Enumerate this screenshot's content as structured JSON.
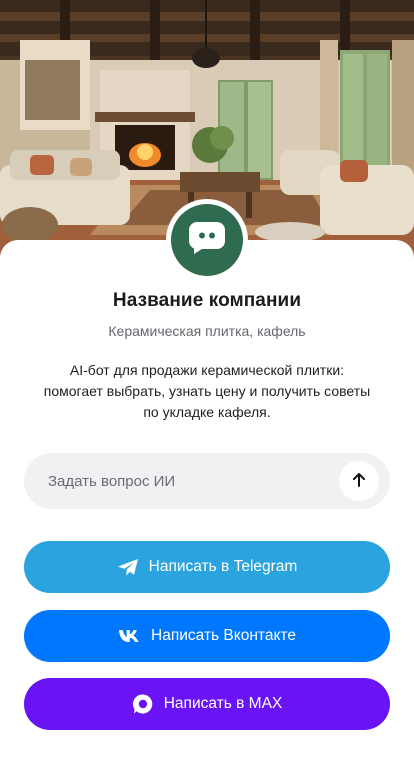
{
  "company": {
    "name": "Название компании",
    "category": "Керамическая плитка, кафель",
    "description": "AI-бот для продажи керамической плитки: помогает выбрать, узнать цену и получить советы по укладке кафеля."
  },
  "ask": {
    "placeholder": "Задать вопрос ИИ",
    "value": "",
    "send_icon": "arrow-up-icon"
  },
  "buttons": {
    "telegram": {
      "label": "Написать в Telegram",
      "icon": "telegram-icon",
      "color": "#2aa3df"
    },
    "vk": {
      "label": "Написать Вконтакте",
      "icon": "vk-icon",
      "color": "#0077ff"
    },
    "max": {
      "label": "Написать в MAX",
      "icon": "max-icon",
      "color": "#6a14f5"
    }
  },
  "colors": {
    "avatar": "#2f6b4f",
    "text": "#1b1b1f",
    "muted": "#66666e",
    "input_bg": "#f1f1f3"
  }
}
